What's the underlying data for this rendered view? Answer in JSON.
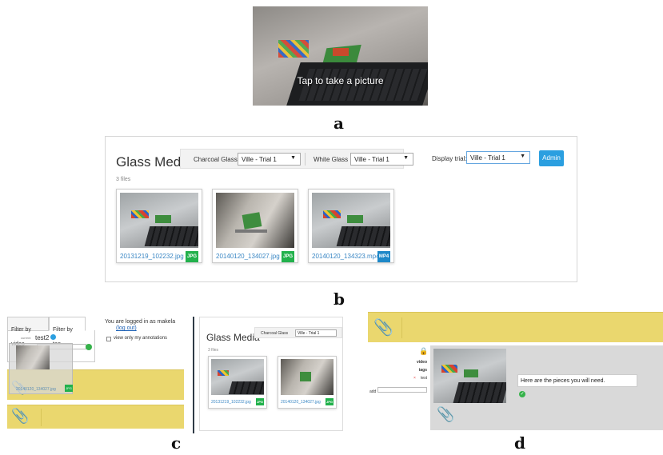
{
  "panel_a": {
    "caption": "a",
    "camera_prompt": "Tap to take a picture"
  },
  "panel_b": {
    "caption": "b",
    "title": "Glass Media",
    "charcoal_label": "Charcoal Glass",
    "charcoal_value": "Ville - Trial 1",
    "white_label": "White Glass",
    "white_value": "Ville - Trial 1",
    "display_trial_label": "Display trial:",
    "display_trial_value": "Ville - Trial 1",
    "admin_label": "Admin",
    "file_count": "3 files",
    "files": [
      {
        "name": "20131219_102232.jpg",
        "type": "JPG",
        "type_color": "#22b14c"
      },
      {
        "name": "20140120_134027.jpg",
        "type": "JPG",
        "type_color": "#22b14c"
      },
      {
        "name": "20140120_134323.mp4",
        "type": "MP4",
        "type_color": "#1e88c8"
      }
    ]
  },
  "panel_c": {
    "caption": "c",
    "tab_video": "Filter by video",
    "tab_tag": "Filter by tag",
    "logged_in": "You are logged in as makela",
    "logout": "(log out)",
    "only_mine": "view only my annotations",
    "tag_current": "current",
    "tag_name": "test2",
    "add_tag_label": "add tag to",
    "drag_file": "20140120_134027.jpg",
    "drag_type": "JPG",
    "mini_title": "Glass Media",
    "mini_charcoal_label": "Charcoal Glass",
    "mini_charcoal_value": "Ville - Trial 1",
    "mini_file_count": "3 files",
    "mini_files": [
      {
        "name": "20131219_102232.jpg",
        "type": "JPG"
      },
      {
        "name": "20140120_134027.jpg",
        "type": "JPG"
      }
    ]
  },
  "panel_d": {
    "caption": "d",
    "side_items": [
      "video",
      "tags",
      "test"
    ],
    "add_label": "add",
    "note_text": "Here are the pieces you will need."
  },
  "colors": {
    "accent": "#2b9fe0",
    "jpg_badge": "#22b14c",
    "mp4_badge": "#1e88c8",
    "annotation_yellow": "#ead76e",
    "annotation_panel": "#d9d9d9"
  }
}
